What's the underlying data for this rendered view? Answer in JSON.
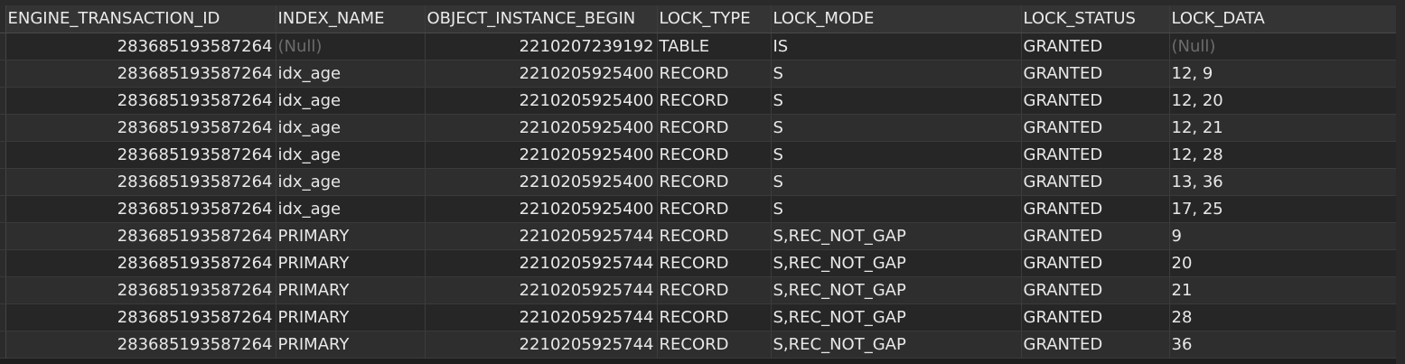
{
  "grid": {
    "columns": [
      "ENGINE_TRANSACTION_ID",
      "INDEX_NAME",
      "OBJECT_INSTANCE_BEGIN",
      "LOCK_TYPE",
      "LOCK_MODE",
      "LOCK_STATUS",
      "LOCK_DATA"
    ],
    "rows": [
      [
        "283685193587264",
        "(Null)",
        "2210207239192",
        "TABLE",
        "IS",
        "GRANTED",
        "(Null)"
      ],
      [
        "283685193587264",
        "idx_age",
        "2210205925400",
        "RECORD",
        "S",
        "GRANTED",
        "12, 9"
      ],
      [
        "283685193587264",
        "idx_age",
        "2210205925400",
        "RECORD",
        "S",
        "GRANTED",
        "12, 20"
      ],
      [
        "283685193587264",
        "idx_age",
        "2210205925400",
        "RECORD",
        "S",
        "GRANTED",
        "12, 21"
      ],
      [
        "283685193587264",
        "idx_age",
        "2210205925400",
        "RECORD",
        "S",
        "GRANTED",
        "12, 28"
      ],
      [
        "283685193587264",
        "idx_age",
        "2210205925400",
        "RECORD",
        "S",
        "GRANTED",
        "13, 36"
      ],
      [
        "283685193587264",
        "idx_age",
        "2210205925400",
        "RECORD",
        "S",
        "GRANTED",
        "17, 25"
      ],
      [
        "283685193587264",
        "PRIMARY",
        "2210205925744",
        "RECORD",
        "S,REC_NOT_GAP",
        "GRANTED",
        "9"
      ],
      [
        "283685193587264",
        "PRIMARY",
        "2210205925744",
        "RECORD",
        "S,REC_NOT_GAP",
        "GRANTED",
        "20"
      ],
      [
        "283685193587264",
        "PRIMARY",
        "2210205925744",
        "RECORD",
        "S,REC_NOT_GAP",
        "GRANTED",
        "21"
      ],
      [
        "283685193587264",
        "PRIMARY",
        "2210205925744",
        "RECORD",
        "S,REC_NOT_GAP",
        "GRANTED",
        "28"
      ],
      [
        "283685193587264",
        "PRIMARY",
        "2210205925744",
        "RECORD",
        "S,REC_NOT_GAP",
        "GRANTED",
        "36"
      ]
    ]
  },
  "colors": {
    "background": "#1e1e1e",
    "header": "#343434",
    "row_odd": "#262626",
    "row_even": "#2e2e2e",
    "text": "#e8e8e8",
    "null_text": "#6c6c6c"
  }
}
